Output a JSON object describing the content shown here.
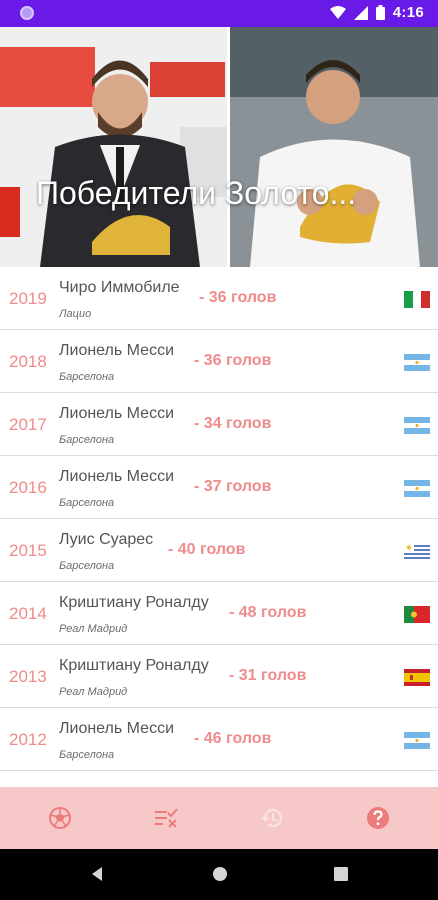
{
  "status_bar": {
    "time": "4:16"
  },
  "header": {
    "title": "Победители Золото..."
  },
  "colors": {
    "status_bar": "#6a1ae6",
    "accent": "#ef8b8b",
    "bottom_bar": "#f7c8c8"
  },
  "winners": [
    {
      "year": "2019",
      "player": "Чиро Иммобиле",
      "club": "Лацио",
      "goals": "- 36 голов",
      "flag": "italy-flag"
    },
    {
      "year": "2018",
      "player": "Лионель Месси",
      "club": "Барселона",
      "goals": "- 36 голов",
      "flag": "argentina-flag"
    },
    {
      "year": "2017",
      "player": "Лионель Месси",
      "club": "Барселона",
      "goals": "- 34 голов",
      "flag": "argentina-flag"
    },
    {
      "year": "2016",
      "player": "Лионель Месси",
      "club": "Барселона",
      "goals": "- 37 голов",
      "flag": "argentina-flag"
    },
    {
      "year": "2015",
      "player": "Луис Суарес",
      "club": "Барселона",
      "goals": "- 40 голов",
      "flag": "uruguay-flag"
    },
    {
      "year": "2014",
      "player": "Криштиану Роналду",
      "club": "Реал Мадрид",
      "goals": "- 48 голов",
      "flag": "portugal-flag"
    },
    {
      "year": "2013",
      "player": "Криштиану Роналду",
      "club": "Реал Мадрид",
      "goals": "- 31 голов",
      "flag": "spain-flag"
    },
    {
      "year": "2012",
      "player": "Лионель Месси",
      "club": "Барселона",
      "goals": "- 46 голов",
      "flag": "argentina-flag"
    }
  ],
  "bottom_nav": [
    {
      "icon": "soccer-ball-icon"
    },
    {
      "icon": "checklist-icon"
    },
    {
      "icon": "history-icon"
    },
    {
      "icon": "help-icon"
    }
  ]
}
